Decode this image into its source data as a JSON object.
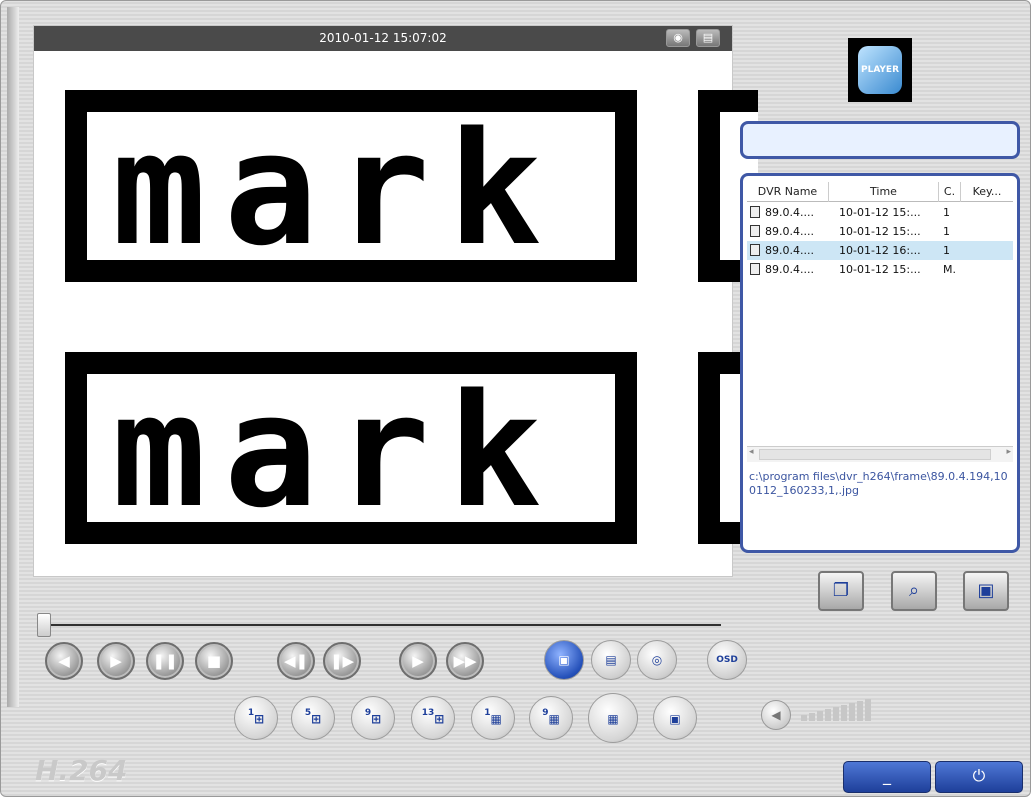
{
  "video": {
    "timestamp": "2010-01-12 15:07:02",
    "camera_icon": "camera-icon",
    "print_icon": "print-icon",
    "mark_text_top": "mark",
    "mark_text_bottom": "mark"
  },
  "playback": {
    "seek_position_percent": 0,
    "buttons": [
      "rewind",
      "play",
      "pause",
      "stop",
      "step-back",
      "step-forward",
      "slow",
      "fast"
    ]
  },
  "tools": [
    "record-clip",
    "print",
    "snapshot",
    "osd"
  ],
  "tools_osd_label": "OSD",
  "layouts": [
    {
      "id": "1ch",
      "sup": "1"
    },
    {
      "id": "5ch",
      "sup": "5"
    },
    {
      "id": "9ch",
      "sup": "9"
    },
    {
      "id": "13ch",
      "sup": "13"
    },
    {
      "id": "1ch-b",
      "sup": "1"
    },
    {
      "id": "9ch-b",
      "sup": "9"
    },
    {
      "id": "16ch",
      "sup": ""
    },
    {
      "id": "pip",
      "sup": ""
    }
  ],
  "volume": {
    "level": 0.15
  },
  "panel": {
    "logo_text": "PLAYER",
    "search_value": "",
    "columns": [
      "DVR Name",
      "Time",
      "C.",
      "Key..."
    ],
    "rows": [
      {
        "dvr": "89.0.4....",
        "time": "10-01-12 15:...",
        "c": "1",
        "key": ""
      },
      {
        "dvr": "89.0.4....",
        "time": "10-01-12 15:...",
        "c": "1",
        "key": ""
      },
      {
        "dvr": "89.0.4....",
        "time": "10-01-12 16:...",
        "c": "1",
        "key": ""
      },
      {
        "dvr": "89.0.4....",
        "time": "10-01-12 15:...",
        "c": "M.",
        "key": ""
      }
    ],
    "selected_row": 2,
    "file_path": "c:\\program files\\dvr_h264\\frame\\89.0.4.194,100112_160233,1,.jpg"
  },
  "panel_buttons": [
    "copy",
    "search-image",
    "search-video"
  ],
  "brand": "H.264",
  "window": {
    "minimize": "_",
    "close": "⏻"
  },
  "colors": {
    "accent": "#3f58a6",
    "selected_row": "#cde6f5"
  }
}
